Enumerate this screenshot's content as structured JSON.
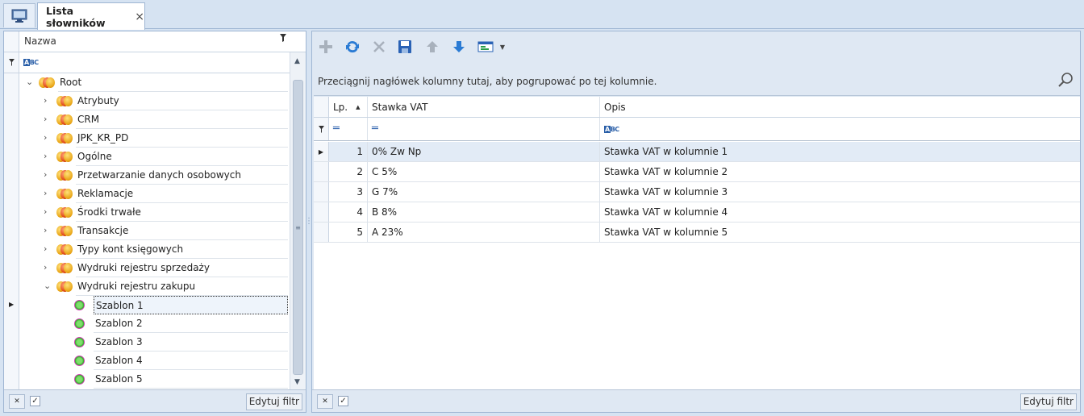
{
  "tabs": {
    "home_icon": "monitor-icon",
    "active_title": "Lista słowników",
    "close_glyph": "×"
  },
  "tree": {
    "column_header": "Nazwa",
    "filter_glyph": "▾",
    "items": [
      {
        "label": "Root",
        "level": 0,
        "expander": "⌄",
        "icon": "coins-icon"
      },
      {
        "label": "Atrybuty",
        "level": 1,
        "expander": "›",
        "icon": "coins-icon"
      },
      {
        "label": "CRM",
        "level": 1,
        "expander": "›",
        "icon": "coins-icon"
      },
      {
        "label": "JPK_KR_PD",
        "level": 1,
        "expander": "›",
        "icon": "coins-icon"
      },
      {
        "label": "Ogólne",
        "level": 1,
        "expander": "›",
        "icon": "coins-icon"
      },
      {
        "label": "Przetwarzanie danych osobowych",
        "level": 1,
        "expander": "›",
        "icon": "coins-icon"
      },
      {
        "label": "Reklamacje",
        "level": 1,
        "expander": "›",
        "icon": "coins-icon"
      },
      {
        "label": "Środki trwałe",
        "level": 1,
        "expander": "›",
        "icon": "coins-icon"
      },
      {
        "label": "Transakcje",
        "level": 1,
        "expander": "›",
        "icon": "coins-icon"
      },
      {
        "label": "Typy kont księgowych",
        "level": 1,
        "expander": "›",
        "icon": "coins-icon"
      },
      {
        "label": "Wydruki rejestru sprzedaży",
        "level": 1,
        "expander": "›",
        "icon": "coins-icon"
      },
      {
        "label": "Wydruki rejestru zakupu",
        "level": 1,
        "expander": "⌄",
        "icon": "coins-icon"
      },
      {
        "label": "Szablon 1",
        "level": 2,
        "expander": "",
        "icon": "gear-icon",
        "selected": true
      },
      {
        "label": "Szablon 2",
        "level": 2,
        "expander": "",
        "icon": "gear-icon"
      },
      {
        "label": "Szablon 3",
        "level": 2,
        "expander": "",
        "icon": "gear-icon"
      },
      {
        "label": "Szablon 4",
        "level": 2,
        "expander": "",
        "icon": "gear-icon"
      },
      {
        "label": "Szablon 5",
        "level": 2,
        "expander": "",
        "icon": "gear-icon"
      }
    ],
    "status": {
      "clear_glyph": "✕",
      "checkbox_glyph": "✓",
      "edit_filter_label": "Edytuj filtr"
    }
  },
  "toolbar": {
    "icons": [
      "add-icon",
      "refresh-icon",
      "delete-icon",
      "save-icon",
      "move-up-icon",
      "move-down-icon",
      "view-options-icon",
      "dropdown-arrow-icon"
    ]
  },
  "grid": {
    "group_hint": "Przeciągnij nagłówek kolumny tutaj, aby pogrupować po tej kolumnie.",
    "columns": {
      "lp": "Lp.",
      "vat": "Stawka VAT",
      "opis": "Opis"
    },
    "rows": [
      {
        "lp": "1",
        "vat": "0% Zw Np",
        "opis": "Stawka VAT w kolumnie 1"
      },
      {
        "lp": "2",
        "vat": "C 5%",
        "opis": "Stawka VAT w kolumnie 2"
      },
      {
        "lp": "3",
        "vat": "G 7%",
        "opis": "Stawka VAT w kolumnie 3"
      },
      {
        "lp": "4",
        "vat": "B 8%",
        "opis": "Stawka VAT w kolumnie 4"
      },
      {
        "lp": "5",
        "vat": "A 23%",
        "opis": "Stawka VAT w kolumnie 5"
      }
    ],
    "status": {
      "clear_glyph": "✕",
      "checkbox_glyph": "✓",
      "edit_filter_label": "Edytuj filtr"
    }
  },
  "colors": {
    "background": "#d6e3f2",
    "accent_blue": "#2a7bd4",
    "border": "#9fb6d3"
  }
}
